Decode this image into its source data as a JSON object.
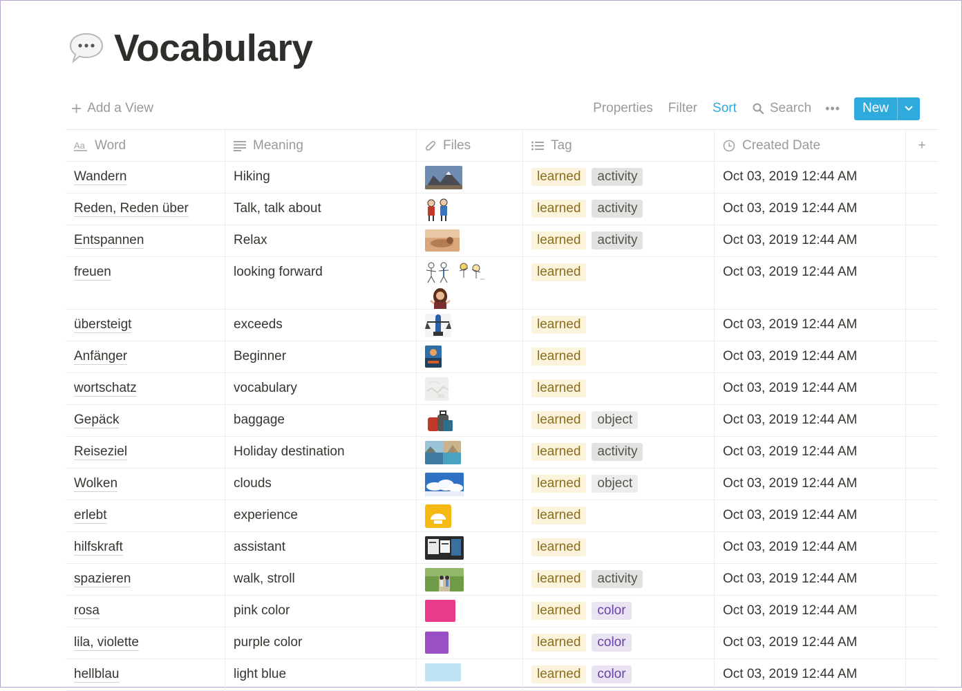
{
  "page": {
    "title": "Vocabulary",
    "icon": "speech-bubble-icon"
  },
  "toolbar": {
    "add_view": "Add a View",
    "properties": "Properties",
    "filter": "Filter",
    "sort": "Sort",
    "search": "Search",
    "new": "New",
    "accent_color": "#2eaadc"
  },
  "columns": [
    {
      "label": "Word",
      "icon": "text-aa-icon"
    },
    {
      "label": "Meaning",
      "icon": "lines-icon"
    },
    {
      "label": "Files",
      "icon": "paperclip-icon"
    },
    {
      "label": "Tag",
      "icon": "list-icon"
    },
    {
      "label": "Created Date",
      "icon": "clock-icon"
    }
  ],
  "tag_colors": {
    "learned": "#fbf3db",
    "activity": "#e3e2e0",
    "object": "#ececeb",
    "color": "#eae4f2"
  },
  "rows": [
    {
      "word": "Wandern",
      "meaning": "Hiking",
      "files": [
        "mountain-photo"
      ],
      "tags": [
        "learned",
        "activity"
      ],
      "date": "Oct 03, 2019 12:44 AM"
    },
    {
      "word": "Reden, Reden über",
      "meaning": "Talk, talk about",
      "files": [
        "people-talking-drawing"
      ],
      "tags": [
        "learned",
        "activity"
      ],
      "date": "Oct 03, 2019 12:44 AM"
    },
    {
      "word": "Entspannen",
      "meaning": "Relax",
      "files": [
        "relaxing-photo"
      ],
      "tags": [
        "learned",
        "activity"
      ],
      "date": "Oct 03, 2019 12:44 AM"
    },
    {
      "word": "freuen",
      "meaning": "looking forward",
      "files": [
        "stick-figures-drawing",
        "happy-figures-drawing",
        "woman-photo"
      ],
      "tags": [
        "learned"
      ],
      "date": "Oct 03, 2019 12:44 AM"
    },
    {
      "word": "übersteigt",
      "meaning": "exceeds",
      "files": [
        "scale-figure"
      ],
      "tags": [
        "learned"
      ],
      "date": "Oct 03, 2019 12:44 AM"
    },
    {
      "word": "Anfänger",
      "meaning": "Beginner",
      "files": [
        "beginner-photo"
      ],
      "tags": [
        "learned"
      ],
      "date": "Oct 03, 2019 12:44 AM"
    },
    {
      "word": "wortschatz",
      "meaning": "vocabulary",
      "files": [
        "map-image"
      ],
      "tags": [
        "learned"
      ],
      "date": "Oct 03, 2019 12:44 AM"
    },
    {
      "word": "Gepäck",
      "meaning": "baggage",
      "files": [
        "luggage-photo"
      ],
      "tags": [
        "learned",
        "object"
      ],
      "date": "Oct 03, 2019 12:44 AM"
    },
    {
      "word": "Reiseziel",
      "meaning": "Holiday destination",
      "files": [
        "destination-collage"
      ],
      "tags": [
        "learned",
        "activity"
      ],
      "date": "Oct 03, 2019 12:44 AM"
    },
    {
      "word": "Wolken",
      "meaning": "clouds",
      "files": [
        "clouds-photo"
      ],
      "tags": [
        "learned",
        "object"
      ],
      "date": "Oct 03, 2019 12:44 AM"
    },
    {
      "word": "erlebt",
      "meaning": "experience",
      "files": [
        "helmet-icon-image"
      ],
      "tags": [
        "learned"
      ],
      "date": "Oct 03, 2019 12:44 AM"
    },
    {
      "word": "hilfskraft",
      "meaning": "assistant",
      "files": [
        "assistant-photo"
      ],
      "tags": [
        "learned"
      ],
      "date": "Oct 03, 2019 12:44 AM"
    },
    {
      "word": "spazieren",
      "meaning": "walk, stroll",
      "files": [
        "walking-photo"
      ],
      "tags": [
        "learned",
        "activity"
      ],
      "date": "Oct 03, 2019 12:44 AM"
    },
    {
      "word": "rosa",
      "meaning": "pink color",
      "files": [
        "pink-swatch"
      ],
      "tags": [
        "learned",
        "color"
      ],
      "date": "Oct 03, 2019 12:44 AM"
    },
    {
      "word": "lila, violette",
      "meaning": "purple color",
      "files": [
        "purple-swatch"
      ],
      "tags": [
        "learned",
        "color"
      ],
      "date": "Oct 03, 2019 12:44 AM"
    },
    {
      "word": "hellblau",
      "meaning": "light blue",
      "files": [
        "light-blue-swatch"
      ],
      "tags": [
        "learned",
        "color"
      ],
      "date": "Oct 03, 2019 12:44 AM"
    }
  ]
}
